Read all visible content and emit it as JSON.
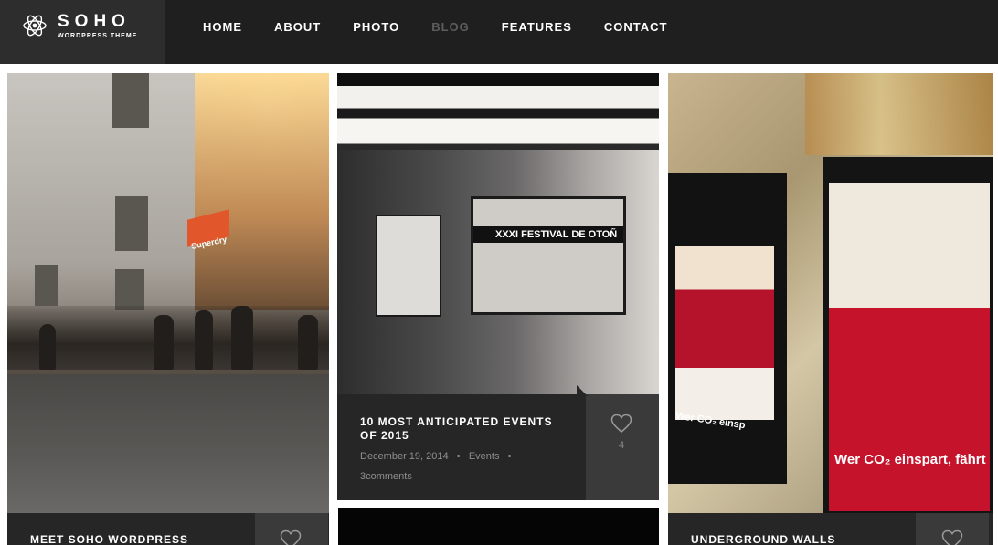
{
  "header": {
    "logo_name": "SOHO",
    "logo_tagline": "WORDPRESS THEME"
  },
  "nav": {
    "items": [
      {
        "label": "HOME",
        "active": false
      },
      {
        "label": "ABOUT",
        "active": false
      },
      {
        "label": "PHOTO",
        "active": false
      },
      {
        "label": "BLOG",
        "active": true
      },
      {
        "label": "FEATURES",
        "active": false
      },
      {
        "label": "CONTACT",
        "active": false
      }
    ]
  },
  "posts": [
    {
      "title": "MEET SOHO WORDPRESS",
      "image_sign": "Superdry"
    },
    {
      "title": "10 MOST ANTICIPATED EVENTS OF 2015",
      "date": "December 19, 2014",
      "category": "Events",
      "comments": "3comments",
      "likes": "4",
      "image_sign": "XXXI FESTIVAL DE OTOÑ"
    },
    {
      "title": "UNDERGROUND WALLS",
      "image_sign": "Wer CO₂ einspart, fährt",
      "image_sign_small": "Wer CO₂ einsp"
    }
  ],
  "colors": {
    "header_bg": "#1f1f1f",
    "logo_bg": "#2d2d2d",
    "panel_bg": "#262626",
    "like_box_bg": "#3a3a3a",
    "nav_active": "#5d5d5d"
  },
  "icons": {
    "logo": "atom-icon",
    "like": "heart-icon"
  }
}
